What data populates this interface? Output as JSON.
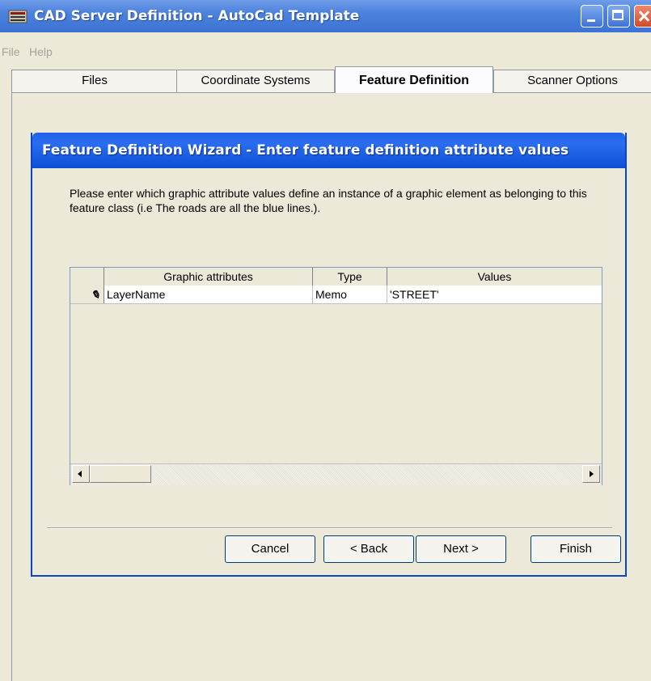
{
  "window": {
    "title": "CAD Server Definition - AutoCad Template"
  },
  "menu": {
    "file": "File",
    "help": "Help"
  },
  "tabs": [
    {
      "label": "Files"
    },
    {
      "label": "Coordinate Systems"
    },
    {
      "label": "Feature Definition",
      "active": true
    },
    {
      "label": "Scanner Options"
    }
  ],
  "wizard": {
    "title": "Feature Definition Wizard - Enter feature definition attribute values",
    "instructions": "Please enter which graphic attribute values define an instance of a graphic element as belonging to this feature class (i.e The roads are all the blue lines.).",
    "grid": {
      "columns": [
        "Graphic attributes",
        "Type",
        "Values"
      ],
      "rows": [
        {
          "indicator_icon": "pencil-icon",
          "attribute": "LayerName",
          "type": "Memo",
          "value": "'STREET'"
        }
      ]
    },
    "buttons": {
      "cancel": "Cancel",
      "back": "< Back",
      "next": "Next >",
      "finish": "Finish"
    }
  },
  "colors": {
    "titlebar": "#3c73d4",
    "wizard_title": "#0c4fd6",
    "window_bg": "#ece9d8"
  }
}
